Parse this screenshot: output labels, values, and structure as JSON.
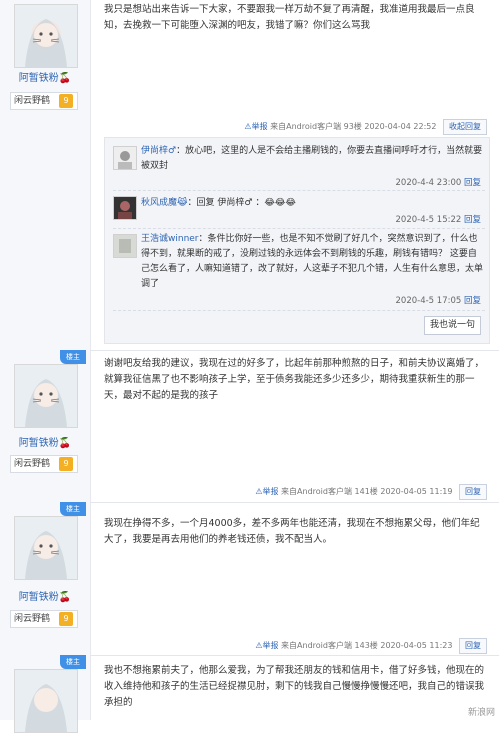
{
  "colors": {
    "link": "#2d64b3",
    "badge_blue": "#3f90e6",
    "level_orange": "#f4b024"
  },
  "user": {
    "name": "阿暂铁粉",
    "fan_label": "闲云野鹤",
    "level": "9",
    "lz_badge": "楼主"
  },
  "posts": [
    {
      "content": "我只是想站出来告诉一下大家，不要跟我一样万劫不复了再清醒，我准道用我最后一点良知，去挽救一下可能堕入深渊的吧友，我错了嘛？你们这么骂我",
      "report": "举报",
      "source": "来自Android客户端",
      "floor": "93楼",
      "time": "2020-04-04 22:52",
      "action": "收起回复"
    },
    {
      "content": "谢谢吧友给我的建议，我现在过的好多了，比起年前那种煎熬的日子，和前夫协议离婚了，就算我征信黑了也不影响孩子上学，至于债务我能还多少还多少，期待我重获新生的那一天，最对不起的是我的孩子",
      "report": "举报",
      "source": "来自Android客户端",
      "floor": "141楼",
      "time": "2020-04-05 11:19",
      "action": "回复"
    },
    {
      "content": "我现在挣得不多，一个月4000多，差不多两年也能还清，我现在不想拖累父母，他们年纪大了，我要是再去用他们的养老钱还债，我不配当人。",
      "report": "举报",
      "source": "来自Android客户端",
      "floor": "143楼",
      "time": "2020-04-05 11:23",
      "action": "回复"
    },
    {
      "content": "我也不想拖累前夫了，他那么爱我，为了帮我还朋友的钱和信用卡，借了好多钱，他现在的收入维持他和孩子的生活已经捉襟见肘，剩下的钱我自己慢慢挣慢慢还吧，我自己的错误我承担的"
    }
  ],
  "replies": [
    {
      "name": "伊尚梓♂",
      "text": "：放心吧，这里的人是不会给主播刷钱的，你要去直播间呼吁才行，当然就要被双封",
      "time": "2020-4-4 23:00",
      "reply_label": "回复"
    },
    {
      "name": "秋风成魔😹",
      "text": "：回复 伊尚梓♂ ：😂😂😂",
      "time": "2020-4-5 15:22",
      "reply_label": "回复"
    },
    {
      "name": "王浩诚winner",
      "text": "：条件比你好一些，也是不知不觉刷了好几个，突然意识到了，什么也得不到，就果断的戒了，没刷过钱的永远体会不到刷钱的乐趣，刷钱有错吗？ 这要自己怎么看了，人嘛知道错了，改了就好，人这辈子不犯几个错，人生有什么意思，太单调了",
      "time": "2020-4-5 17:05",
      "reply_label": "回复"
    }
  ],
  "reply_box_label": "我也说一句",
  "watermark": "新浪网"
}
